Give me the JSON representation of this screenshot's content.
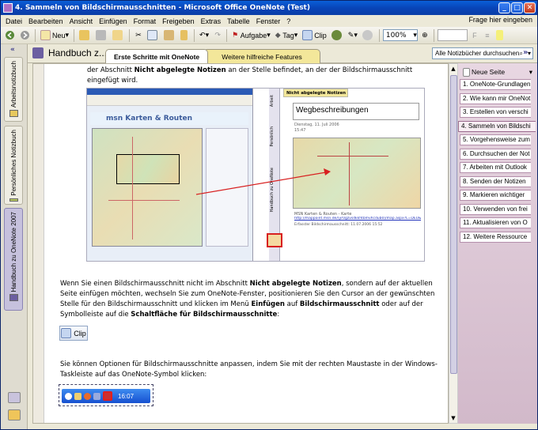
{
  "window": {
    "title": "4. Sammeln von Bildschirmausschnitten - Microsoft Office OneNote (Test)",
    "min": "_",
    "max": "□",
    "close": "✕"
  },
  "menu": {
    "items": [
      "Datei",
      "Bearbeiten",
      "Ansicht",
      "Einfügen",
      "Format",
      "Freigeben",
      "Extras",
      "Tabelle",
      "Fenster",
      "?"
    ],
    "help_placeholder": "Frage hier eingeben"
  },
  "toolbar": {
    "new_label": "Neu",
    "task_label": "Aufgabe",
    "tag_label": "Tag",
    "clip_label": "Clip",
    "zoom": "100%"
  },
  "sidebar": {
    "notebooks": [
      "Arbeitsnotizbuch",
      "Persönliches Notizbuch",
      "Handbuch zu OneNote 2007"
    ]
  },
  "header": {
    "notebook_title": "Handbuch z...",
    "tabs": [
      "Erste Schritte mit OneNote",
      "Weitere hilfreiche Features"
    ],
    "search_placeholder": "Alle Notizbücher durchsuchen"
  },
  "page": {
    "para1_a": "der Abschnitt ",
    "para1_b": "Nicht abgelegte Notizen",
    "para1_c": " an der Stelle befindet, an der der Bildschirmausschnitt eingefügt wird.",
    "para2_a": "Wenn Sie einen Bildschirmausschnitt nicht im Abschnitt ",
    "para2_b": "Nicht abgelegte Notizen",
    "para2_c": ", sondern auf der aktuellen Seite einfügen möchten, wechseln Sie zum OneNote-Fenster, positionieren Sie den Cursor an der gewünschten Stelle für den Bildschirmausschnitt und klicken im Menü ",
    "para2_d": "Einfügen",
    "para2_e": " auf ",
    "para2_f": "Bildschirmausschnitt",
    "para2_g": " oder auf der Symbolleiste auf die ",
    "para2_h": "Schaltfläche für Bildschirmausschnitte",
    "para2_i": ":",
    "clip_button": "Clip",
    "para3": "Sie können Optionen für Bildschirmausschnitte anpassen, indem Sie mit der rechten Maustaste in der Windows-Taskleiste auf das OneNote-Symbol klicken:",
    "taskbar_clock": "16:07"
  },
  "screenshot": {
    "map_header": "msn Karten & Routen",
    "note_tab": "Nicht abgelegte Notizen",
    "note_title": "Wegbeschreibungen",
    "note_date": "Dienstag, 11. Juli 2006",
    "note_time": "15:47",
    "note_src": "MSN Karten & Routen - Karte",
    "note_link": "http://mappoint.msn.de/(yr0gzvsdkkf4bmvhcdub0)/map.aspx?L=DEU&C=...",
    "note_ins": "Erfasster Bildschirmausschnitt: 11.07.2006 15:52",
    "side_tabs": [
      "Arbeit",
      "Persönlich",
      "Handbuch zu OneNote"
    ]
  },
  "pagelist": {
    "new_page": "Neue Seite",
    "pages": [
      "1. OneNote-Grundlagen",
      "2. Wie kann mir OneNot",
      "3. Erstellen von verschi",
      "4. Sammeln von Bildschi",
      "5. Vorgehensweise zum",
      "6. Durchsuchen der Not",
      "7. Arbeiten mit Outlook",
      "8. Senden der Notizen",
      "9. Markieren wichtiger",
      "10. Verwenden von frei",
      "11. Aktualisieren von O",
      "12. Weitere Ressource"
    ],
    "selected_index": 3
  }
}
